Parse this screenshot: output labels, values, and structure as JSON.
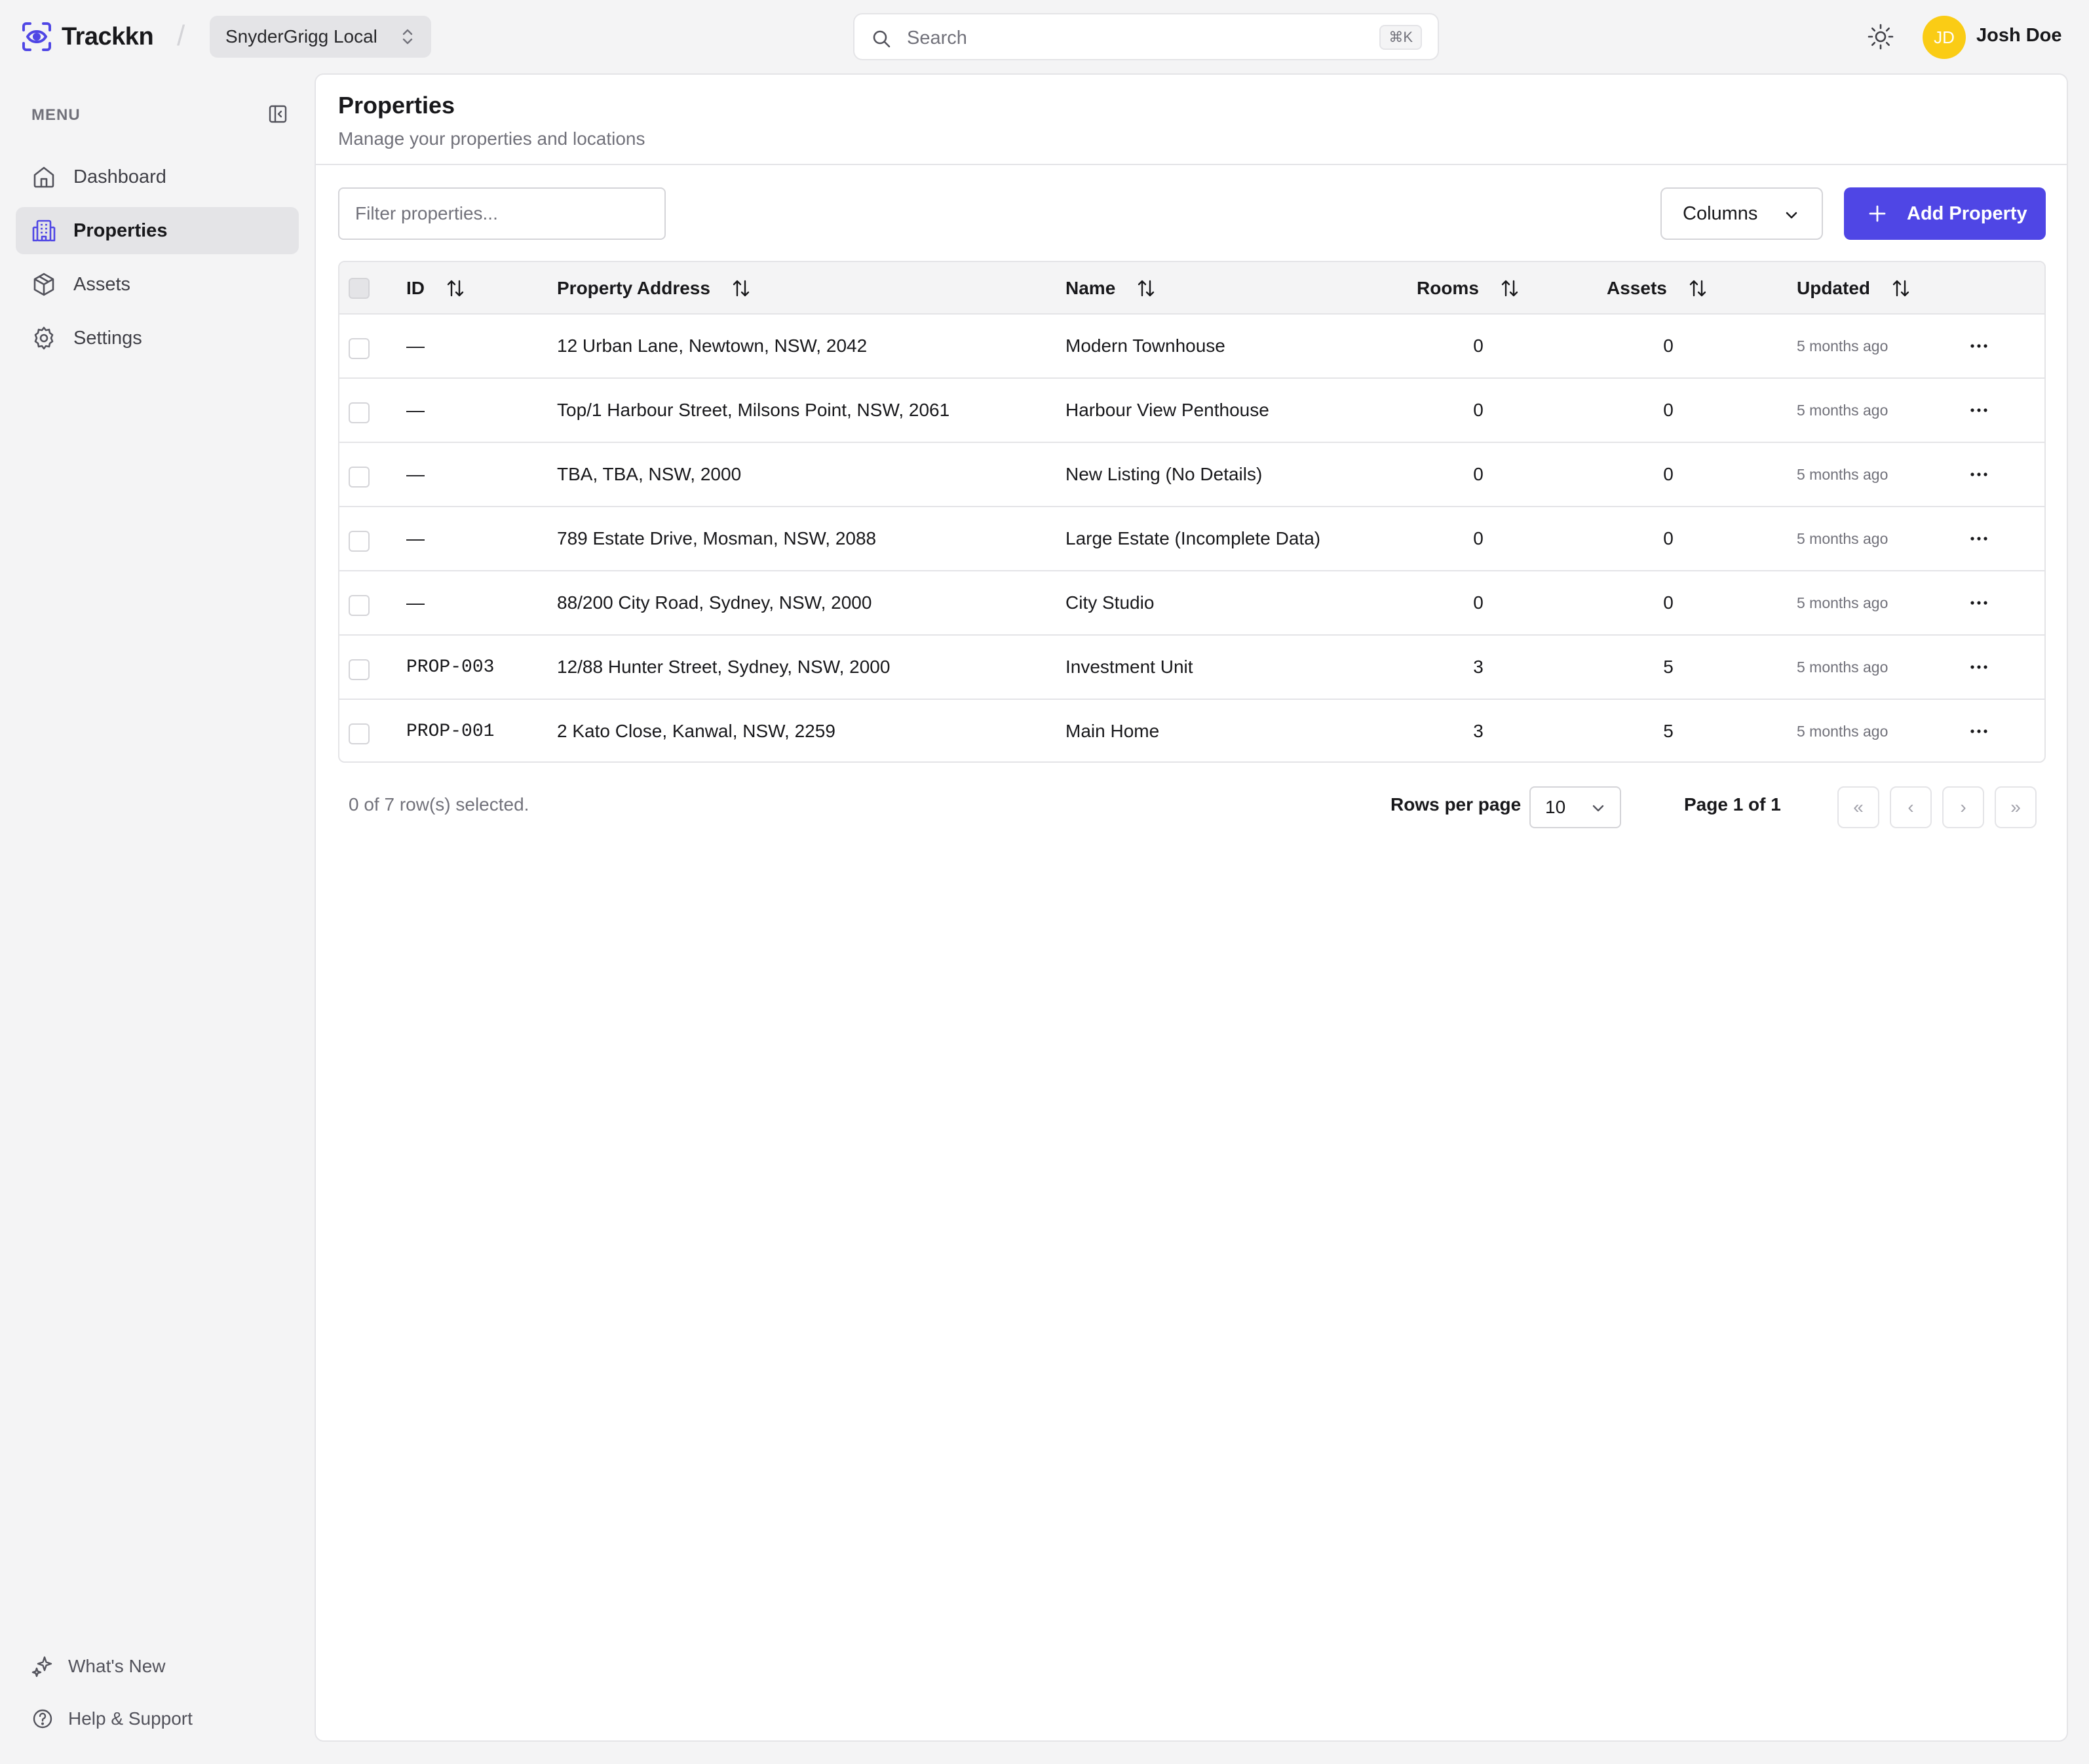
{
  "app": {
    "name": "Trackkn"
  },
  "workspace": {
    "name": "SnyderGrigg Local"
  },
  "search": {
    "placeholder": "Search",
    "shortcut": "⌘K"
  },
  "user": {
    "initials": "JD",
    "name": "Josh Doe"
  },
  "sidebar": {
    "menu_label": "MENU",
    "items": [
      {
        "label": "Dashboard",
        "icon": "home-icon",
        "active": false
      },
      {
        "label": "Properties",
        "icon": "building-icon",
        "active": true
      },
      {
        "label": "Assets",
        "icon": "box-icon",
        "active": false
      },
      {
        "label": "Settings",
        "icon": "gear-icon",
        "active": false
      }
    ],
    "footer": [
      {
        "label": "What's New",
        "icon": "sparkles-icon"
      },
      {
        "label": "Help & Support",
        "icon": "help-circle-icon"
      }
    ]
  },
  "page": {
    "title": "Properties",
    "subtitle": "Manage your properties and locations"
  },
  "toolbar": {
    "filter_placeholder": "Filter properties...",
    "columns_label": "Columns",
    "add_label": "Add Property"
  },
  "table": {
    "columns": [
      "ID",
      "Property Address",
      "Name",
      "Rooms",
      "Assets",
      "Updated"
    ],
    "rows": [
      {
        "id": "—",
        "address": "12 Urban Lane, Newtown, NSW, 2042",
        "name": "Modern Townhouse",
        "rooms": "0",
        "assets": "0",
        "updated": "5 months ago"
      },
      {
        "id": "—",
        "address": "Top/1 Harbour Street, Milsons Point, NSW, 2061",
        "name": "Harbour View Penthouse",
        "rooms": "0",
        "assets": "0",
        "updated": "5 months ago"
      },
      {
        "id": "—",
        "address": "TBA, TBA, NSW, 2000",
        "name": "New Listing (No Details)",
        "rooms": "0",
        "assets": "0",
        "updated": "5 months ago"
      },
      {
        "id": "—",
        "address": "789 Estate Drive, Mosman, NSW, 2088",
        "name": "Large Estate (Incomplete Data)",
        "rooms": "0",
        "assets": "0",
        "updated": "5 months ago"
      },
      {
        "id": "—",
        "address": "88/200 City Road, Sydney, NSW, 2000",
        "name": "City Studio",
        "rooms": "0",
        "assets": "0",
        "updated": "5 months ago"
      },
      {
        "id": "PROP-003",
        "address": "12/88 Hunter Street, Sydney, NSW, 2000",
        "name": "Investment Unit",
        "rooms": "3",
        "assets": "5",
        "updated": "5 months ago"
      },
      {
        "id": "PROP-001",
        "address": "2 Kato Close, Kanwal, NSW, 2259",
        "name": "Main Home",
        "rooms": "3",
        "assets": "5",
        "updated": "5 months ago"
      }
    ]
  },
  "pagination": {
    "selection_text": "0 of 7 row(s) selected.",
    "rows_per_page_label": "Rows per page",
    "rows_per_page_value": "10",
    "page_info": "Page 1 of 1",
    "first": "«",
    "prev": "‹",
    "next": "›",
    "last": "»"
  },
  "colors": {
    "accent": "#4f46e5",
    "avatar": "#facc15"
  }
}
